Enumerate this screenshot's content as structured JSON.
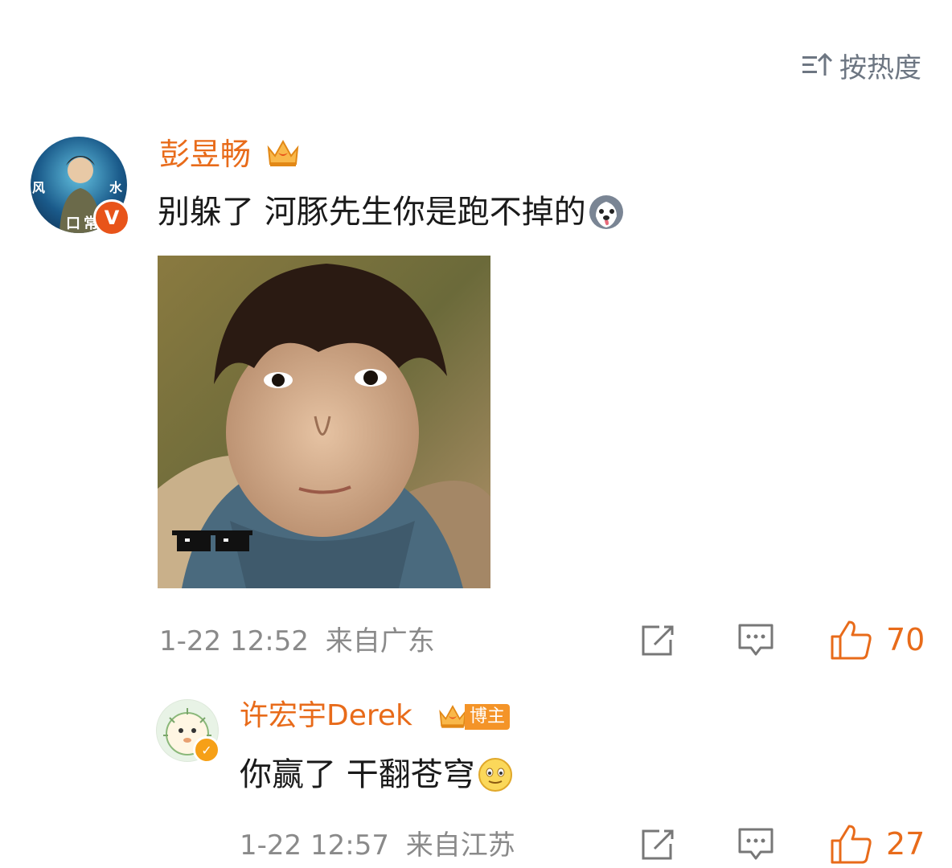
{
  "sort": {
    "label": "按热度"
  },
  "comments": [
    {
      "username": "彭昱畅",
      "avatar_text": [
        "风",
        "水",
        "口",
        "常"
      ],
      "text": "别躲了 河豚先生你是跑不掉的",
      "time": "1-22 12:52",
      "location": "来自广东",
      "likes": "70"
    }
  ],
  "reply": {
    "username": "许宏宇Derek",
    "badge": "博主",
    "text": "你赢了 干翻苍穹",
    "time": "1-22 12:57",
    "location": "来自江苏",
    "likes": "27"
  },
  "colors": {
    "accent": "#e86b1a",
    "meta": "#8a8a8a",
    "icon": "#6d7682"
  },
  "icons": [
    "sort-icon",
    "crown-icon",
    "verified-icon",
    "husky-emoji",
    "share-icon",
    "comment-icon",
    "like-icon",
    "smile-emoji"
  ]
}
